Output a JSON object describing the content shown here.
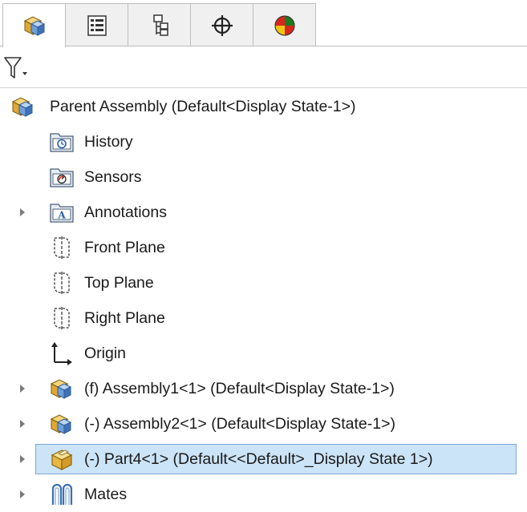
{
  "tabs": [
    {
      "name": "featuremanager-tab",
      "icon": "assembly-cube-icon"
    },
    {
      "name": "propertymanager-tab",
      "icon": "property-list-icon"
    },
    {
      "name": "configurationmanager-tab",
      "icon": "configuration-tree-icon"
    },
    {
      "name": "dimxpertmanager-tab",
      "icon": "crosshair-icon"
    },
    {
      "name": "displaymanager-tab",
      "icon": "color-ball-icon"
    }
  ],
  "filter": {
    "icon": "filter-funnel-icon",
    "dropdown_icon": "chevron-down-icon"
  },
  "tree": {
    "root": {
      "label": "Parent Assembly  (Default<Display State-1>)",
      "icon": "assembly-icon"
    },
    "items": [
      {
        "label": "History",
        "icon": "history-folder-icon",
        "expandable": false
      },
      {
        "label": "Sensors",
        "icon": "sensors-folder-icon",
        "expandable": false
      },
      {
        "label": "Annotations",
        "icon": "annotations-folder-icon",
        "expandable": true
      },
      {
        "label": "Front Plane",
        "icon": "plane-icon",
        "expandable": false
      },
      {
        "label": "Top Plane",
        "icon": "plane-icon",
        "expandable": false
      },
      {
        "label": "Right Plane",
        "icon": "plane-icon",
        "expandable": false
      },
      {
        "label": "Origin",
        "icon": "origin-icon",
        "expandable": false
      },
      {
        "label": "(f) Assembly1<1> (Default<Display State-1>)",
        "icon": "assembly-icon",
        "expandable": true
      },
      {
        "label": "(-) Assembly2<1> (Default<Display State-1>)",
        "icon": "assembly-icon",
        "expandable": true
      },
      {
        "label": "(-) Part4<1> (Default<<Default>_Display State 1>)",
        "icon": "part-icon",
        "expandable": true,
        "selected": true
      },
      {
        "label": "Mates",
        "icon": "mates-icon",
        "expandable": true
      }
    ]
  },
  "colors": {
    "selection_fill": "#cce4f7",
    "selection_border": "#7aa7d6"
  }
}
